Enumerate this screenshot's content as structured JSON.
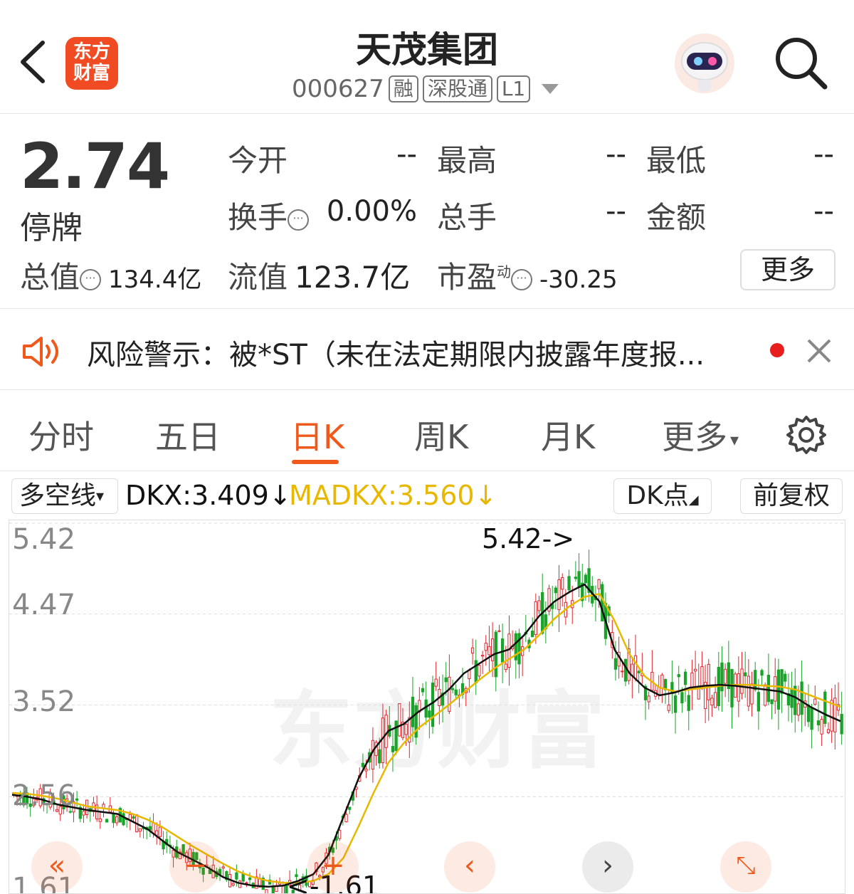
{
  "header": {
    "logo_line1": "东方",
    "logo_line2": "财富",
    "stock_name": "天茂集团",
    "stock_code": "000627",
    "tags": [
      "融",
      "深股通",
      "L1"
    ]
  },
  "quote": {
    "price": "2.74",
    "status": "停牌",
    "open_label": "今开",
    "open_value": "--",
    "high_label": "最高",
    "high_value": "--",
    "low_label": "最低",
    "low_value": "--",
    "turnover_label": "换手",
    "turnover_value": "0.00%",
    "volume_label": "总手",
    "volume_value": "--",
    "amount_label": "金额",
    "amount_value": "--",
    "total_cap_label": "总值",
    "total_cap_value": "134.4亿",
    "float_cap_label": "流值",
    "float_cap_value": "123.7亿",
    "pe_label": "市盈",
    "pe_sup": "动",
    "pe_value": "-30.25",
    "more_label": "更多"
  },
  "risk": {
    "text": "风险警示：被*ST（未在法定期限内披露年度报..."
  },
  "tabs": [
    "分时",
    "五日",
    "日K",
    "周K",
    "月K",
    "更多"
  ],
  "active_tab": "日K",
  "indicator": {
    "selector_label": "多空线",
    "dkx": "DKX:3.409↓",
    "madkx": "MADKX:3.560↓",
    "dk_button": "DK点",
    "adjust_button": "前复权"
  },
  "chart_data": {
    "type": "candlestick",
    "y_ticks": [
      "5.42",
      "4.47",
      "3.52",
      "2.56",
      "1.61"
    ],
    "ylim": [
      1.61,
      5.42
    ],
    "max_label": "5.42->",
    "min_label": "<-1.61",
    "watermark": "东方财富",
    "dkx_series": [
      2.58,
      2.56,
      2.53,
      2.48,
      2.45,
      2.42,
      2.4,
      2.38,
      2.3,
      2.22,
      2.1,
      1.98,
      1.9,
      1.82,
      1.72,
      1.66,
      1.63,
      1.62,
      1.63,
      1.68,
      1.75,
      1.95,
      2.35,
      2.75,
      3.05,
      3.25,
      3.32,
      3.45,
      3.55,
      3.68,
      3.85,
      3.95,
      4.05,
      4.1,
      4.25,
      4.45,
      4.6,
      4.7,
      4.78,
      4.6,
      4.1,
      3.85,
      3.7,
      3.62,
      3.65,
      3.7,
      3.72,
      3.73,
      3.72,
      3.7,
      3.68,
      3.66,
      3.6,
      3.5,
      3.42,
      3.35
    ],
    "madkx_series": [
      2.6,
      2.59,
      2.57,
      2.54,
      2.5,
      2.46,
      2.44,
      2.42,
      2.38,
      2.32,
      2.24,
      2.14,
      2.04,
      1.95,
      1.86,
      1.78,
      1.72,
      1.68,
      1.66,
      1.66,
      1.68,
      1.75,
      1.92,
      2.25,
      2.6,
      2.92,
      3.12,
      3.28,
      3.4,
      3.52,
      3.65,
      3.78,
      3.9,
      4.0,
      4.1,
      4.25,
      4.42,
      4.55,
      4.65,
      4.68,
      4.4,
      4.05,
      3.82,
      3.7,
      3.66,
      3.68,
      3.7,
      3.72,
      3.73,
      3.73,
      3.72,
      3.71,
      3.68,
      3.62,
      3.56,
      3.5
    ]
  },
  "colors": {
    "accent": "#ef5a1c",
    "up": "#e3262d",
    "down": "#1aa32a",
    "dkx": "#111111",
    "madkx": "#e8b800"
  }
}
